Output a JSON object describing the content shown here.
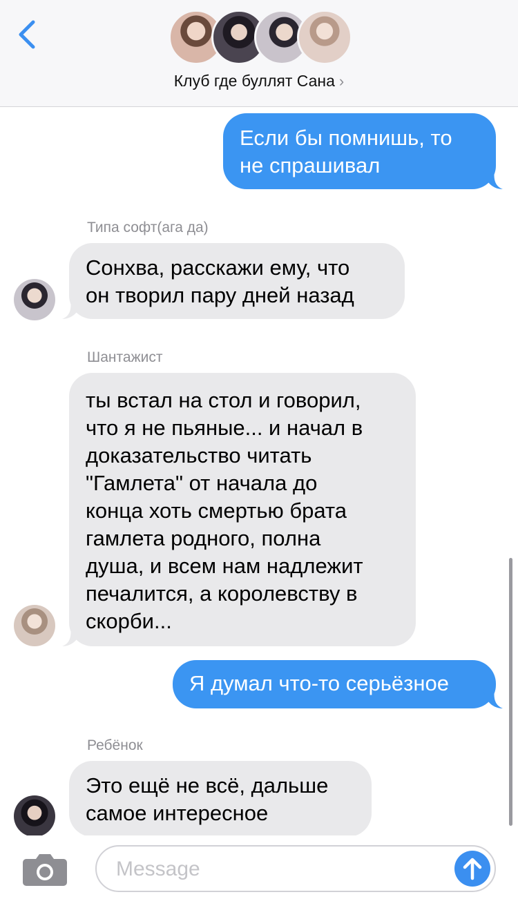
{
  "header": {
    "back_icon": "chevron-left-icon",
    "title": "Клуб где буллят Сана",
    "title_chevron": "›",
    "avatars": [
      {
        "icon": "avatar-member",
        "color": "#d9b6a8"
      },
      {
        "icon": "avatar-member",
        "color": "#4a4450"
      },
      {
        "icon": "avatar-member",
        "color": "#c9c3cb"
      },
      {
        "icon": "avatar-member",
        "color": "#e2cfc7"
      }
    ]
  },
  "messages": [
    {
      "direction": "outgoing",
      "lines": [
        "Если бы помнишь, то",
        "не спрашивал"
      ]
    },
    {
      "direction": "incoming",
      "sender": "Типа софт(ага да)",
      "lines": [
        "Сонхва, расскажи ему, что",
        "он творил пару дней назад"
      ],
      "avatar_color": "#c8c4cc"
    },
    {
      "direction": "incoming",
      "sender": "Шантажист",
      "lines": [
        "ты встал на стол и говорил,",
        "что я не пьяные... и начал в",
        "доказательство читать",
        "\"Гамлета\" от начала до",
        "конца хоть смертью брата",
        "гамлета родного, полна",
        "душа, и всем нам надлежит",
        "печалится, а королевству в",
        "скорби..."
      ],
      "avatar_color": "#d8c8bf"
    },
    {
      "direction": "outgoing",
      "lines": [
        "Я думал что-то серьёзное"
      ]
    },
    {
      "direction": "incoming",
      "sender": "Ребёнок",
      "lines": [
        "Это ещё не всё, дальше",
        "самое интересное"
      ],
      "avatar_color": "#3a3640"
    }
  ],
  "composer": {
    "camera_icon": "camera-icon",
    "placeholder": "Message",
    "send_icon": "arrow-up-icon"
  },
  "colors": {
    "accent": "#3b95f2",
    "incoming_bubble": "#e9e9eb",
    "meta_text": "#8e8e93"
  }
}
